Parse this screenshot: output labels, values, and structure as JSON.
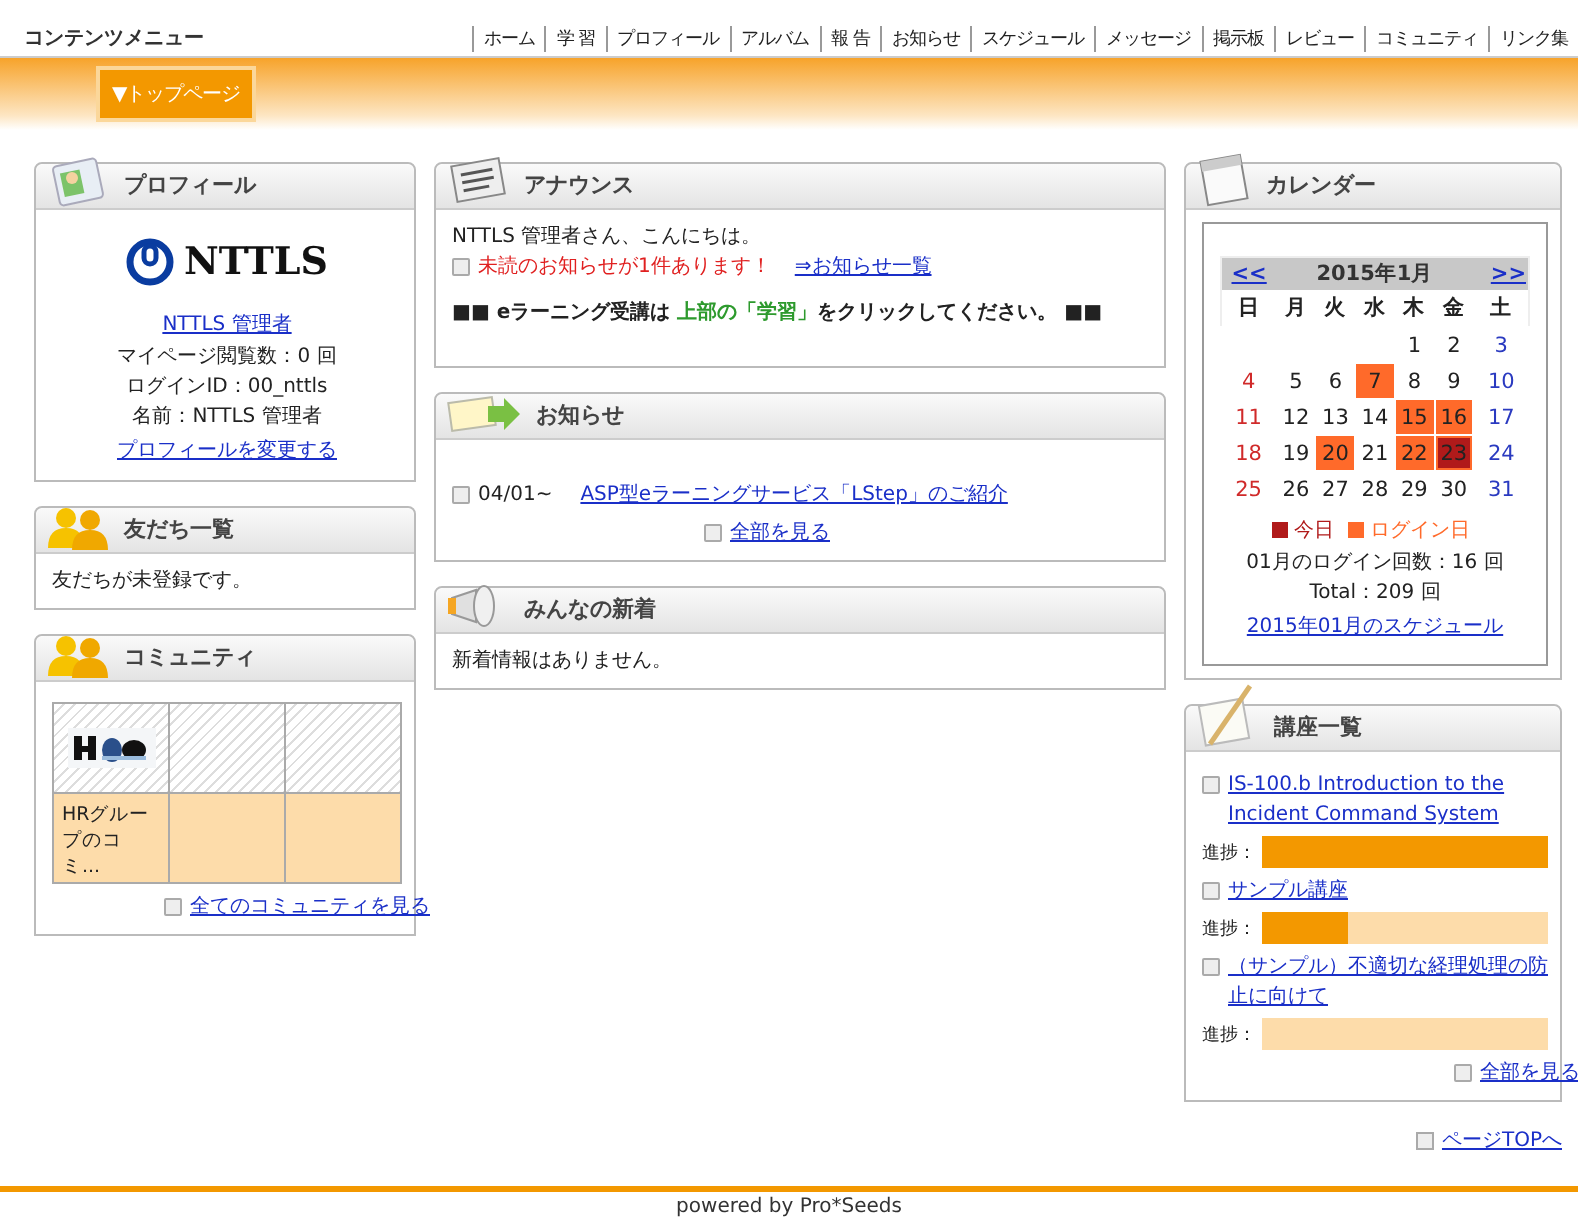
{
  "menu_title": "コンテンツメニュー",
  "nav": [
    "ホーム",
    "学 習",
    "プロフィール",
    "アルバム",
    "報 告",
    "お知らせ",
    "スケジュール",
    "メッセージ",
    "掲示板",
    "レビュー",
    "コミュニティ",
    "リンク集"
  ],
  "top_button": "▼トップページ",
  "profile": {
    "title": "プロフィール",
    "logo_text": "NTTLS",
    "name_link": "NTTLS  管理者",
    "lines": [
      "マイページ閲覧数：0 回",
      "ログインID：00_nttls",
      "名前：NTTLS  管理者"
    ],
    "edit_link": "プロフィールを変更する"
  },
  "friends": {
    "title": "友だち一覧",
    "message": "友だちが未登録です。"
  },
  "community": {
    "title": "コミュニティ",
    "cells": [
      {
        "kind": "picture",
        "name": "HRグループのコミ..."
      },
      {
        "kind": "empty"
      },
      {
        "kind": "empty"
      }
    ],
    "more_link": "全てのコミュニティを見る"
  },
  "announce": {
    "title": "アナウンス",
    "greeting": "NTTLS  管理者さん、こんにちは。",
    "unread": "未読のお知らせが1件あります！",
    "list_link": "⇒お知らせ一覧",
    "notice": [
      {
        "text": "■■ eラーニング受講は ",
        "highlight": false
      },
      {
        "text": "上部の「学習」",
        "highlight": true
      },
      {
        "text": "をクリックしてください。 ■■",
        "highlight": false
      }
    ]
  },
  "news": {
    "title": "お知らせ",
    "items": [
      {
        "date": "04/01~",
        "link": "ASP型eラーニングサービス「LStep」のご紹介"
      }
    ],
    "more_link": "全部を見る"
  },
  "updates": {
    "title": "みんなの新着",
    "message": "新着情報はありません。"
  },
  "calendar": {
    "title": "カレンダー",
    "prev": "<<",
    "month": "2015年1月",
    "next": ">>",
    "weekdays": [
      "日",
      "月",
      "火",
      "水",
      "木",
      "金",
      "土"
    ],
    "weeks": [
      [
        {
          "day": "1",
          "login": false,
          "today": false
        },
        {
          "day": "2",
          "login": false,
          "today": false
        },
        {
          "day": "3",
          "login": false,
          "today": false
        }
      ],
      [
        {
          "day": "4",
          "login": false,
          "today": false
        },
        {
          "day": "5",
          "login": false,
          "today": false
        },
        {
          "day": "6",
          "login": false,
          "today": false
        },
        {
          "day": "7",
          "login": true,
          "today": false
        },
        {
          "day": "8",
          "login": false,
          "today": false
        },
        {
          "day": "9",
          "login": false,
          "today": false
        },
        {
          "day": "10",
          "login": false,
          "today": false
        }
      ],
      [
        {
          "day": "11",
          "login": false,
          "today": false
        },
        {
          "day": "12",
          "login": false,
          "today": false
        },
        {
          "day": "13",
          "login": false,
          "today": false
        },
        {
          "day": "14",
          "login": false,
          "today": false
        },
        {
          "day": "15",
          "login": true,
          "today": false
        },
        {
          "day": "16",
          "login": true,
          "today": false
        },
        {
          "day": "17",
          "login": false,
          "today": false
        }
      ],
      [
        {
          "day": "18",
          "login": false,
          "today": false
        },
        {
          "day": "19",
          "login": false,
          "today": false
        },
        {
          "day": "20",
          "login": true,
          "today": false
        },
        {
          "day": "21",
          "login": false,
          "today": false
        },
        {
          "day": "22",
          "login": true,
          "today": false
        },
        {
          "day": "23",
          "login": true,
          "today": true
        },
        {
          "day": "24",
          "login": false,
          "today": false
        }
      ],
      [
        {
          "day": "25",
          "login": false,
          "today": false
        },
        {
          "day": "26",
          "login": false,
          "today": false
        },
        {
          "day": "27",
          "login": false,
          "today": false
        },
        {
          "day": "28",
          "login": false,
          "today": false
        },
        {
          "day": "29",
          "login": false,
          "today": false
        },
        {
          "day": "30",
          "login": false,
          "today": false
        },
        {
          "day": "31",
          "login": false,
          "today": false
        }
      ]
    ],
    "legend": [
      {
        "label": "今日",
        "color": "#b01a1a"
      },
      {
        "label": "ログイン日",
        "color": "#ff6a2a"
      }
    ],
    "login_count": "01月のログイン回数：16 回",
    "total": "Total：209 回",
    "schedule_link": "2015年01月のスケジュール"
  },
  "courses": {
    "title": "講座一覧",
    "items": [
      {
        "link": "IS-100.b Introduction to the Incident Command System",
        "progress_label": "進捗：",
        "level": 1.0
      },
      {
        "link": "サンプル講座",
        "progress_label": "進捗：",
        "level": 0.3
      },
      {
        "link": "（サンプル）不適切な経理処理の防止に向けて",
        "progress_label": "進捗：",
        "level": 0
      }
    ],
    "more_link": "全部を見る"
  },
  "page_top": "ページTOPへ",
  "footer": "powered by Pro*Seeds"
}
